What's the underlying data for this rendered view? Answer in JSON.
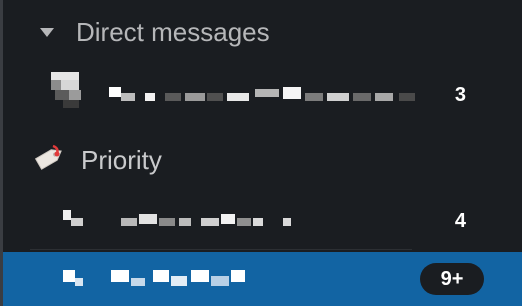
{
  "sidebar": {
    "direct_messages": {
      "label": "Direct messages",
      "item": {
        "count": "3"
      }
    },
    "priority": {
      "label": "Priority",
      "icon": "tag-icon",
      "item": {
        "count": "4"
      },
      "selected_item": {
        "badge": "9+"
      }
    }
  },
  "colors": {
    "background": "#1a1d21",
    "selected": "#1264a3",
    "text_muted": "#b6b7b9",
    "text_strong": "#ffffff"
  }
}
